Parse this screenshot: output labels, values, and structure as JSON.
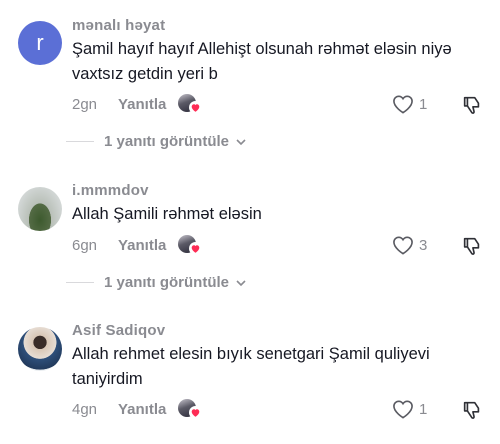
{
  "comments": [
    {
      "avatar_letter": "r",
      "username": "mənalı həyat",
      "text": "Şamil hayıf hayıf Allehişt olsunah rəhmət eləsin niyə vaxtsız getdin yeri b",
      "time": "2gn",
      "reply_label": "Yanıtla",
      "likes": "1",
      "view_replies": "1 yanıtı görüntüle"
    },
    {
      "username": "i.mmmdov",
      "text": "Allah Şamili rəhmət eləsin",
      "time": "6gn",
      "reply_label": "Yanıtla",
      "likes": "3",
      "view_replies": "1 yanıtı görüntüle"
    },
    {
      "username": "Asif Sadiqov",
      "text": "Allah rehmet elesin bıyık senetgari Şamil quliyevi taniyirdim",
      "time": "4gn",
      "reply_label": "Yanıtla",
      "likes": "1"
    }
  ],
  "icons": {
    "heart": "heart-outline-icon",
    "dislike": "thumbs-down-icon",
    "chevron": "chevron-down-icon",
    "creator_heart": "creator-liked-heart-icon"
  },
  "colors": {
    "muted": "#8a8b91",
    "heart_accent": "#fe2c55",
    "avatar_r": "#5b6fd6"
  }
}
